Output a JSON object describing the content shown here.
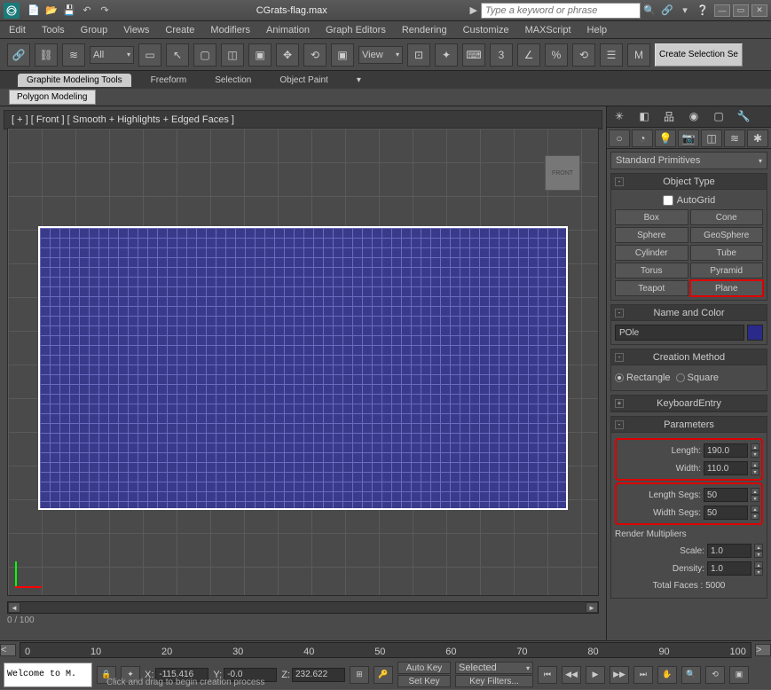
{
  "title": "CGrats-flag.max",
  "search_placeholder": "Type a keyword or phrase",
  "menu": [
    "Edit",
    "Tools",
    "Group",
    "Views",
    "Create",
    "Modifiers",
    "Animation",
    "Graph Editors",
    "Rendering",
    "Customize",
    "MAXScript",
    "Help"
  ],
  "toolbar_dd": "All",
  "view_dd": "View",
  "create_sel": "Create Selection Se",
  "ribbon_tabs": [
    "Graphite Modeling Tools",
    "Freeform",
    "Selection",
    "Object Paint"
  ],
  "polygon_modeling": "Polygon Modeling",
  "viewport_label": "[ + ] [ Front ] [ Smooth + Highlights + Edged Faces ]",
  "viewcube": "FRONT",
  "frame_ind": "0 / 100",
  "cmd": {
    "primitives_dd": "Standard Primitives",
    "object_type": "Object Type",
    "autogrid": "AutoGrid",
    "buttons": [
      "Box",
      "Cone",
      "Sphere",
      "GeoSphere",
      "Cylinder",
      "Tube",
      "Torus",
      "Pyramid",
      "Teapot",
      "Plane"
    ],
    "name_color": "Name and Color",
    "obj_name": "POle",
    "creation_method": "Creation Method",
    "rect": "Rectangle",
    "square": "Square",
    "keyboard_entry": "KeyboardEntry",
    "parameters": "Parameters",
    "length_lbl": "Length:",
    "length_val": "190.0",
    "width_lbl": "Width:",
    "width_val": "110.0",
    "lsegs_lbl": "Length Segs:",
    "lsegs_val": "50",
    "wsegs_lbl": "Width Segs:",
    "wsegs_val": "50",
    "render_mult": "Render Multipliers",
    "scale_lbl": "Scale:",
    "scale_val": "1.0",
    "density_lbl": "Density:",
    "density_val": "1.0",
    "total_faces": "Total Faces : 5000"
  },
  "timeline_ticks": [
    "0",
    "10",
    "20",
    "30",
    "40",
    "50",
    "60",
    "70",
    "80",
    "90",
    "100"
  ],
  "coords": {
    "x_lbl": "X:",
    "x": "-115.416",
    "y_lbl": "Y:",
    "y": "-0.0",
    "z_lbl": "Z:",
    "z": "232.622"
  },
  "autokey": "Auto Key",
  "setkey": "Set Key",
  "selected": "Selected",
  "keyfilters": "Key Filters...",
  "welcome": "Welcome to M.",
  "status": "Click and drag to begin creation process"
}
